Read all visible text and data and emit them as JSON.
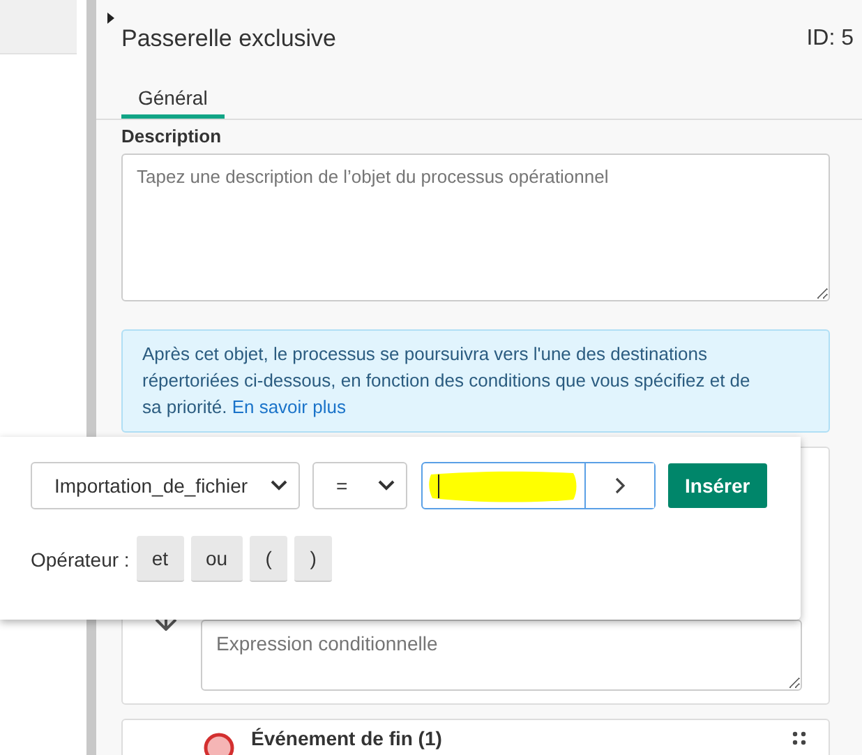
{
  "panel": {
    "title": "Passerelle exclusive",
    "id_label": "ID: 5",
    "tabs": [
      {
        "label": "Général",
        "selected": true
      }
    ],
    "description": {
      "label": "Description",
      "placeholder": "Tapez une description de l’objet du processus opérationnel"
    },
    "info": {
      "text": "Après cet objet, le processus se poursuivra vers l'une des destinations répertoriées ci-dessous, en fonction des conditions que vous spécifiez et de sa priorité.",
      "link": "En savoir plus"
    },
    "condition": {
      "placeholder": "Expression conditionnelle"
    },
    "next_item": {
      "label": "Événement de fin (1)"
    }
  },
  "popup": {
    "variable": "Importation_de_fichier",
    "operator": "=",
    "value_field": {
      "focused": true,
      "redacted": true
    },
    "insert_button": "Insérer",
    "operator_label": "Opérateur :",
    "operators": [
      "et",
      "ou",
      "(",
      ")"
    ]
  }
}
